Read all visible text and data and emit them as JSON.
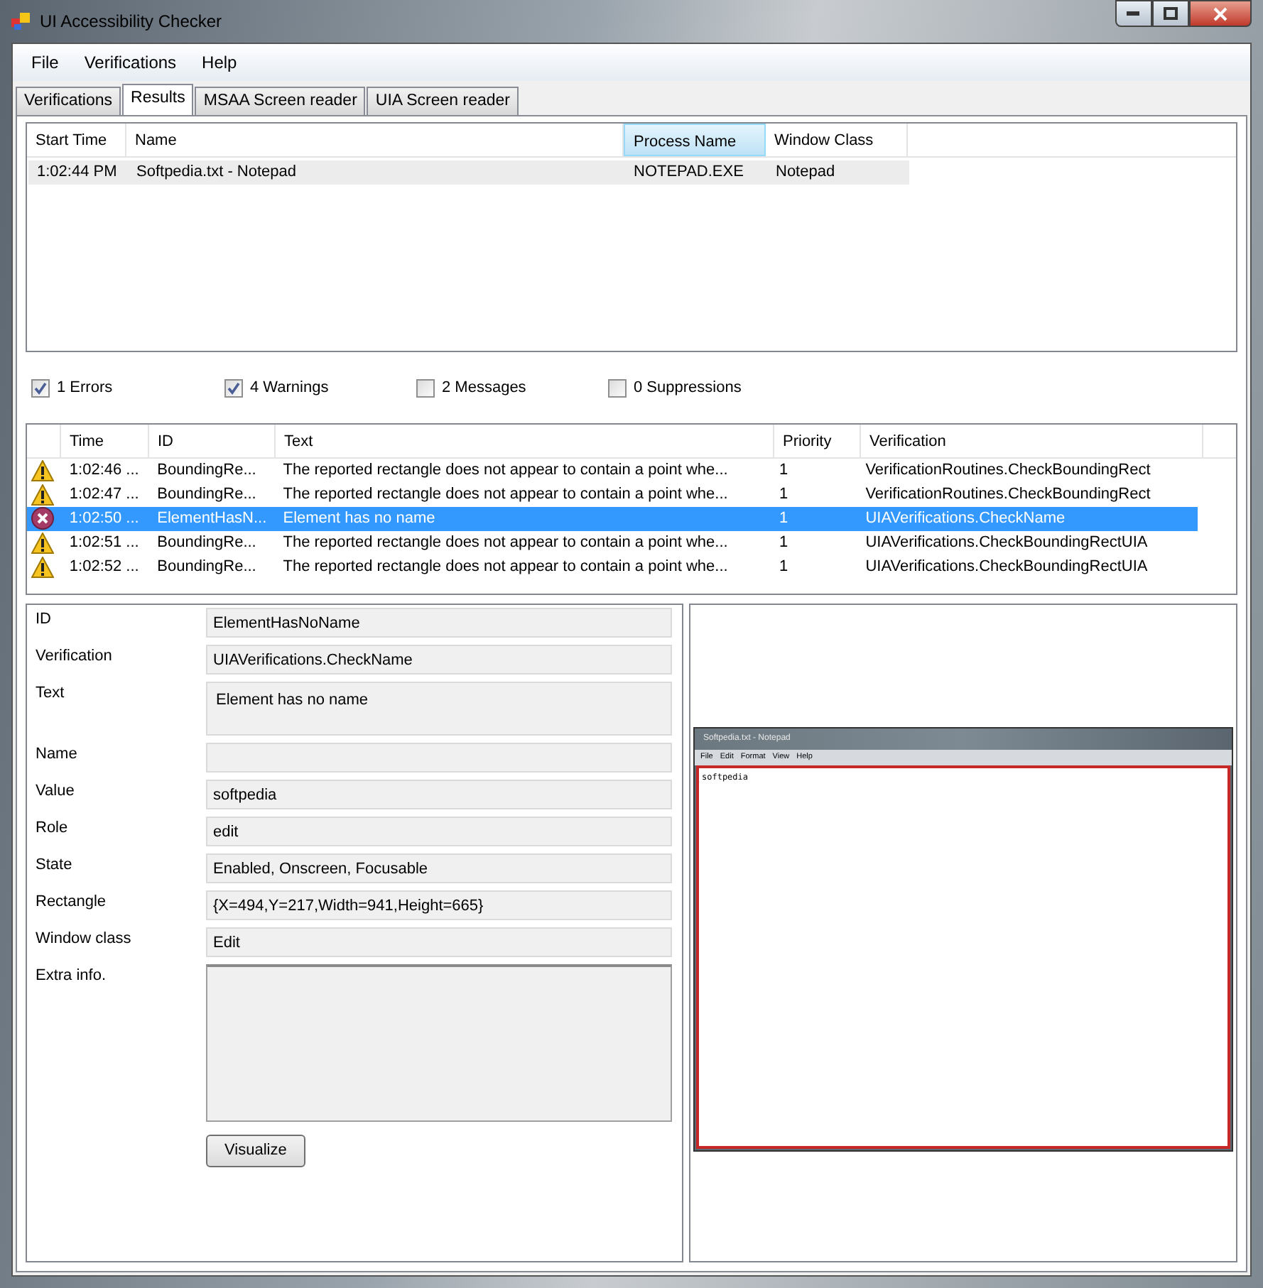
{
  "window": {
    "title": "UI Accessibility Checker"
  },
  "menu": [
    "File",
    "Verifications",
    "Help"
  ],
  "tabs": [
    {
      "label": "Verifications",
      "selected": false
    },
    {
      "label": "Results",
      "selected": true
    },
    {
      "label": "MSAA Screen reader",
      "selected": false
    },
    {
      "label": "UIA Screen reader",
      "selected": false
    }
  ],
  "processes": {
    "columns": [
      {
        "label": "Start Time",
        "highlighted": false
      },
      {
        "label": "Name",
        "highlighted": false
      },
      {
        "label": "Process Name",
        "highlighted": true
      },
      {
        "label": "Window Class",
        "highlighted": false
      }
    ],
    "rows": [
      {
        "selected": true,
        "cells": [
          "1:02:44 PM",
          "Softpedia.txt - Notepad",
          "NOTEPAD.EXE",
          "Notepad"
        ]
      }
    ]
  },
  "filters": [
    {
      "label": "1 Errors",
      "checked": true
    },
    {
      "label": "4 Warnings",
      "checked": true
    },
    {
      "label": "2 Messages",
      "checked": false
    },
    {
      "label": "0 Suppressions",
      "checked": false
    }
  ],
  "issues": {
    "columns": [
      "Time",
      "ID",
      "Text",
      "Priority",
      "Verification"
    ],
    "rows": [
      {
        "kind": "warning",
        "selected": false,
        "cells": [
          "1:02:46 ...",
          "BoundingRe...",
          "The reported rectangle does not appear to contain a point whe...",
          "1",
          "VerificationRoutines.CheckBoundingRect"
        ]
      },
      {
        "kind": "warning",
        "selected": false,
        "cells": [
          "1:02:47 ...",
          "BoundingRe...",
          "The reported rectangle does not appear to contain a point whe...",
          "1",
          "VerificationRoutines.CheckBoundingRect"
        ]
      },
      {
        "kind": "error",
        "selected": true,
        "cells": [
          "1:02:50 ...",
          "ElementHasN...",
          "Element has no name",
          "1",
          "UIAVerifications.CheckName"
        ]
      },
      {
        "kind": "warning",
        "selected": false,
        "cells": [
          "1:02:51 ...",
          "BoundingRe...",
          "The reported rectangle does not appear to contain a point whe...",
          "1",
          "UIAVerifications.CheckBoundingRectUIA"
        ]
      },
      {
        "kind": "warning",
        "selected": false,
        "cells": [
          "1:02:52 ...",
          "BoundingRe...",
          "The reported rectangle does not appear to contain a point whe...",
          "1",
          "UIAVerifications.CheckBoundingRectUIA"
        ]
      }
    ]
  },
  "details": [
    {
      "label": "ID",
      "value": "ElementHasNoName",
      "kind": "line"
    },
    {
      "label": "Verification",
      "value": "UIAVerifications.CheckName",
      "kind": "line"
    },
    {
      "label": "Text",
      "value": "Element has no name",
      "kind": "text"
    },
    {
      "label": "Name",
      "kind": "line"
    },
    {
      "label": "Value",
      "value": "softpedia",
      "kind": "line"
    },
    {
      "label": "Role",
      "value": "edit",
      "kind": "line"
    },
    {
      "label": "State",
      "value": "Enabled, Onscreen, Focusable",
      "kind": "line"
    },
    {
      "label": "Rectangle",
      "value": "{X=494,Y=217,Width=941,Height=665}",
      "kind": "line"
    },
    {
      "label": "Window class",
      "value": "Edit",
      "kind": "line"
    },
    {
      "label": "Extra info.",
      "kind": "area"
    }
  ],
  "visualize_button": "Visualize",
  "preview": {
    "title": "Softpedia.txt - Notepad",
    "menu": [
      "File",
      "Edit",
      "Format",
      "View",
      "Help"
    ],
    "text": "softpedia"
  }
}
